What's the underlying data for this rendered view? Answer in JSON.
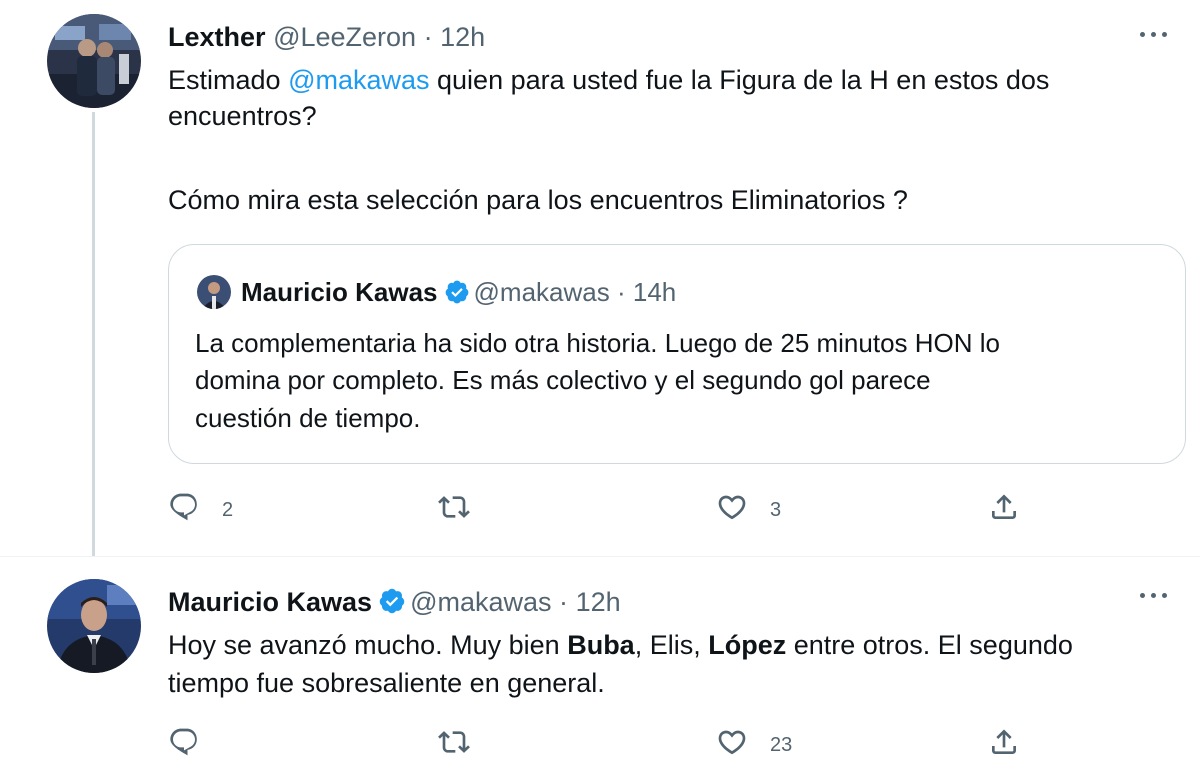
{
  "tweet1": {
    "name": "Lexther",
    "handle": "@LeeZeron",
    "dot": "·",
    "time": "12h",
    "text_before_mention": "Estimado ",
    "mention": "@makawas",
    "text_after_mention": " quien para usted fue la Figura de la H en estos dos",
    "line2": "encuentros?",
    "line3": "Cómo mira esta selección para los encuentros Eliminatorios ?",
    "quote": {
      "name": "Mauricio Kawas",
      "handle": "@makawas",
      "dot": "·",
      "time": "14h",
      "line1": "La complementaria ha sido otra historia. Luego de 25 minutos HON lo",
      "line2": "domina por completo. Es más colectivo y el segundo gol parece",
      "line3": "cuestión de tiempo."
    },
    "reply_count": "2",
    "retweet_count": "",
    "like_count": "3"
  },
  "tweet2": {
    "name": "Mauricio Kawas",
    "handle": "@makawas",
    "dot": "·",
    "time": "12h",
    "seg1": "Hoy se avanzó mucho. Muy bien ",
    "bold1": "Buba",
    "seg2": ", Elis, ",
    "bold2": "López",
    "seg3": " entre otros. El segundo",
    "line2": "tiempo fue sobresaliente en general.",
    "reply_count": "",
    "retweet_count": "",
    "like_count": "23"
  },
  "colors": {
    "accent": "#1d9bf0",
    "muted": "#536471",
    "border": "#cfd9de",
    "text": "#0f1419"
  },
  "icons": [
    "reply-icon",
    "retweet-icon",
    "like-icon",
    "share-icon",
    "verified-icon",
    "more-icon"
  ]
}
